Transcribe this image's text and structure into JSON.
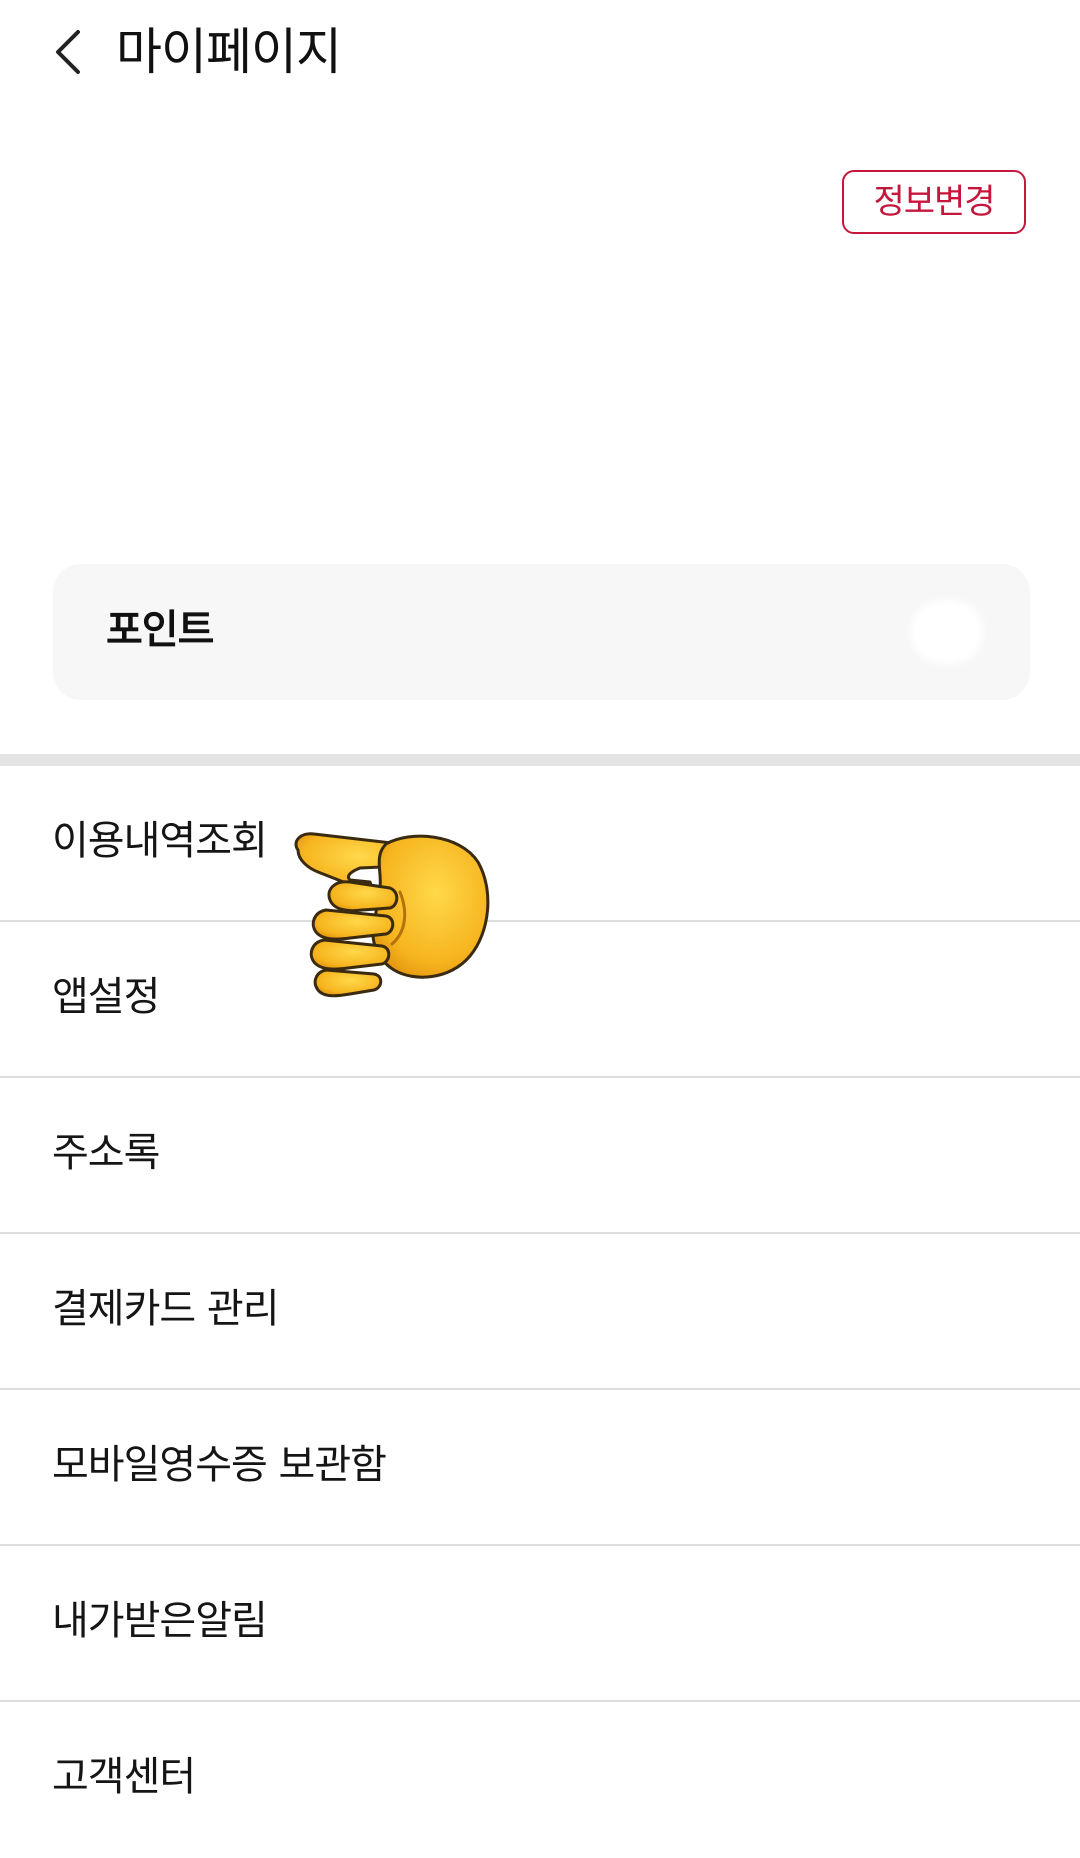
{
  "header": {
    "back_icon": "chevron-left-icon",
    "title": "마이페이지"
  },
  "profile": {
    "edit_button_label": "정보변경",
    "accent_color": "#c5163c"
  },
  "points": {
    "label": "포인트"
  },
  "menu": {
    "items": [
      {
        "label": "이용내역조회"
      },
      {
        "label": "앱설정"
      },
      {
        "label": "주소록"
      },
      {
        "label": "결제카드 관리"
      },
      {
        "label": "모바일영수증 보관함"
      },
      {
        "label": "내가받은알림"
      },
      {
        "label": "고객센터"
      }
    ]
  },
  "overlay": {
    "icon": "pointing-hand-icon"
  }
}
